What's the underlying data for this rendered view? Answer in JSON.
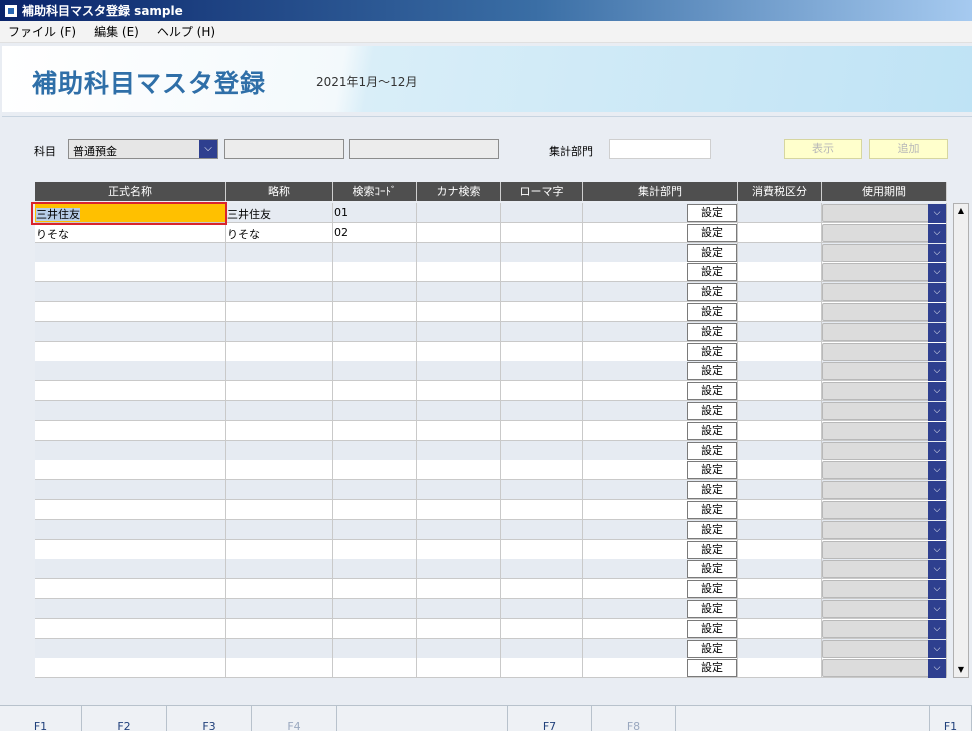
{
  "window": {
    "title": "補助科目マスタ登録 sample"
  },
  "menu": [
    {
      "label": "ファイル (F)"
    },
    {
      "label": "編集 (E)"
    },
    {
      "label": "ヘルプ (H)"
    }
  ],
  "header": {
    "title": "補助科目マスタ登録",
    "period": "2021年1月～12月"
  },
  "filter": {
    "account_label": "科目",
    "account_value": "普通預金",
    "dept_label": "集計部門",
    "show_button": "表示",
    "add_button": "追加"
  },
  "table": {
    "columns": [
      "正式名称",
      "略称",
      "検索ｺｰﾄﾞ",
      "カナ検索",
      "ローマ字",
      "集計部門",
      "消費税区分",
      "使用期間"
    ],
    "set_button_label": "設定",
    "rows": [
      {
        "formal_name": "三井住友",
        "short_name": "三井住友",
        "code": "01",
        "kana": "",
        "romaji": "",
        "tax": "",
        "period": ""
      },
      {
        "formal_name": "りそな",
        "short_name": "りそな",
        "code": "02",
        "kana": "",
        "romaji": "",
        "tax": "",
        "period": ""
      },
      {
        "formal_name": "",
        "short_name": "",
        "code": "",
        "kana": "",
        "romaji": "",
        "tax": "",
        "period": ""
      },
      {
        "formal_name": "",
        "short_name": "",
        "code": "",
        "kana": "",
        "romaji": "",
        "tax": "",
        "period": ""
      },
      {
        "formal_name": "",
        "short_name": "",
        "code": "",
        "kana": "",
        "romaji": "",
        "tax": "",
        "period": ""
      },
      {
        "formal_name": "",
        "short_name": "",
        "code": "",
        "kana": "",
        "romaji": "",
        "tax": "",
        "period": ""
      },
      {
        "formal_name": "",
        "short_name": "",
        "code": "",
        "kana": "",
        "romaji": "",
        "tax": "",
        "period": ""
      },
      {
        "formal_name": "",
        "short_name": "",
        "code": "",
        "kana": "",
        "romaji": "",
        "tax": "",
        "period": ""
      },
      {
        "formal_name": "",
        "short_name": "",
        "code": "",
        "kana": "",
        "romaji": "",
        "tax": "",
        "period": ""
      },
      {
        "formal_name": "",
        "short_name": "",
        "code": "",
        "kana": "",
        "romaji": "",
        "tax": "",
        "period": ""
      },
      {
        "formal_name": "",
        "short_name": "",
        "code": "",
        "kana": "",
        "romaji": "",
        "tax": "",
        "period": ""
      },
      {
        "formal_name": "",
        "short_name": "",
        "code": "",
        "kana": "",
        "romaji": "",
        "tax": "",
        "period": ""
      },
      {
        "formal_name": "",
        "short_name": "",
        "code": "",
        "kana": "",
        "romaji": "",
        "tax": "",
        "period": ""
      },
      {
        "formal_name": "",
        "short_name": "",
        "code": "",
        "kana": "",
        "romaji": "",
        "tax": "",
        "period": ""
      },
      {
        "formal_name": "",
        "short_name": "",
        "code": "",
        "kana": "",
        "romaji": "",
        "tax": "",
        "period": ""
      },
      {
        "formal_name": "",
        "short_name": "",
        "code": "",
        "kana": "",
        "romaji": "",
        "tax": "",
        "period": ""
      },
      {
        "formal_name": "",
        "short_name": "",
        "code": "",
        "kana": "",
        "romaji": "",
        "tax": "",
        "period": ""
      },
      {
        "formal_name": "",
        "short_name": "",
        "code": "",
        "kana": "",
        "romaji": "",
        "tax": "",
        "period": ""
      },
      {
        "formal_name": "",
        "short_name": "",
        "code": "",
        "kana": "",
        "romaji": "",
        "tax": "",
        "period": ""
      },
      {
        "formal_name": "",
        "short_name": "",
        "code": "",
        "kana": "",
        "romaji": "",
        "tax": "",
        "period": ""
      },
      {
        "formal_name": "",
        "short_name": "",
        "code": "",
        "kana": "",
        "romaji": "",
        "tax": "",
        "period": ""
      },
      {
        "formal_name": "",
        "short_name": "",
        "code": "",
        "kana": "",
        "romaji": "",
        "tax": "",
        "period": ""
      },
      {
        "formal_name": "",
        "short_name": "",
        "code": "",
        "kana": "",
        "romaji": "",
        "tax": "",
        "period": ""
      },
      {
        "formal_name": "",
        "short_name": "",
        "code": "",
        "kana": "",
        "romaji": "",
        "tax": "",
        "period": ""
      }
    ]
  },
  "function_keys": [
    {
      "label": "F1",
      "enabled": true
    },
    {
      "label": "F2",
      "enabled": true
    },
    {
      "label": "F3",
      "enabled": true
    },
    {
      "label": "F4",
      "enabled": false
    },
    {
      "label": "",
      "enabled": true
    },
    {
      "label": "F7",
      "enabled": true
    },
    {
      "label": "F8",
      "enabled": false
    },
    {
      "label": "",
      "enabled": true
    },
    {
      "label": "F1",
      "enabled": true
    }
  ],
  "colors": {
    "accent": "#2f6fa8",
    "header_bg": "#4f4f4f",
    "dropdown_arrow": "#2e3f8f",
    "editing_cell": "#ffc000",
    "focus_border": "#d9242c"
  }
}
